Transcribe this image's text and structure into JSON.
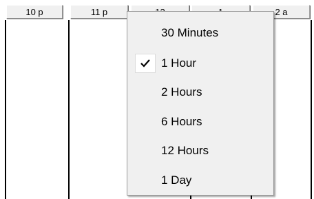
{
  "timeline": {
    "hours": [
      {
        "label": "10 p"
      },
      {
        "label": "11 p"
      },
      {
        "label": "12"
      },
      {
        "label": "1"
      },
      {
        "label": "2 a"
      }
    ]
  },
  "scale_menu": {
    "selected": "1 Hour",
    "items": [
      {
        "label": "30 Minutes",
        "checked": false
      },
      {
        "label": "1 Hour",
        "checked": true
      },
      {
        "label": "2 Hours",
        "checked": false
      },
      {
        "label": "6 Hours",
        "checked": false
      },
      {
        "label": "12 Hours",
        "checked": false
      },
      {
        "label": "1 Day",
        "checked": false
      }
    ]
  }
}
